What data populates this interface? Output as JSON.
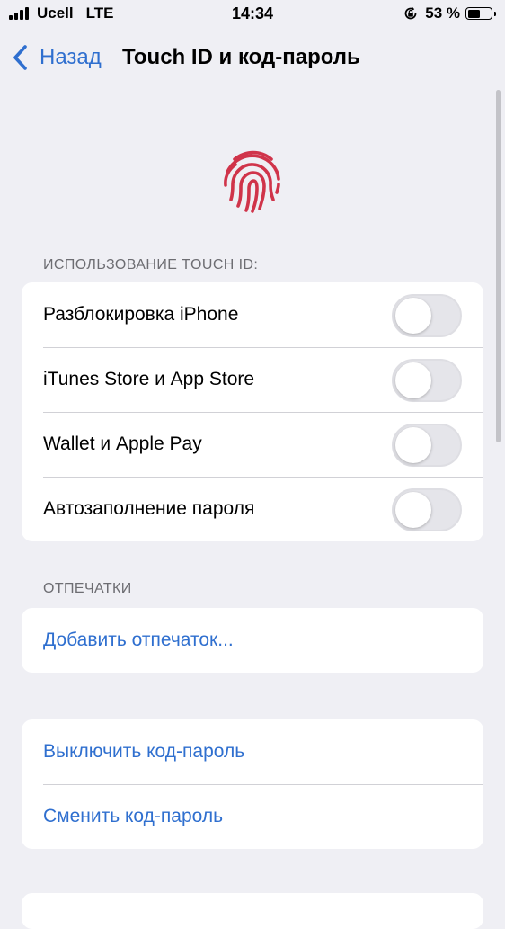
{
  "status_bar": {
    "carrier": "Ucell",
    "network": "LTE",
    "time": "14:34",
    "battery_text": "53 %",
    "battery_level": 0.53,
    "signal_bars": 4
  },
  "nav": {
    "back_label": "Назад",
    "title": "Touch ID и код-пароль"
  },
  "colors": {
    "accent": "#2f6fcf",
    "fingerprint": "#d0344a",
    "background": "#efeff4"
  },
  "icons": {
    "back": "chevron-left-icon",
    "fingerprint": "fingerprint-icon",
    "orientation_lock": "orientation-lock-icon",
    "battery": "battery-icon",
    "signal": "cellular-signal-icon"
  },
  "touch_id_section": {
    "header": "ИСПОЛЬЗОВАНИЕ TOUCH ID:",
    "items": [
      {
        "label": "Разблокировка iPhone",
        "enabled": false
      },
      {
        "label": "iTunes Store и App Store",
        "enabled": false
      },
      {
        "label": "Wallet и Apple Pay",
        "enabled": false
      },
      {
        "label": "Автозаполнение пароля",
        "enabled": false
      }
    ]
  },
  "fingerprints_section": {
    "header": "ОТПЕЧАТКИ",
    "add_label": "Добавить отпечаток..."
  },
  "passcode_section": {
    "turn_off_label": "Выключить код-пароль",
    "change_label": "Сменить код-пароль"
  }
}
